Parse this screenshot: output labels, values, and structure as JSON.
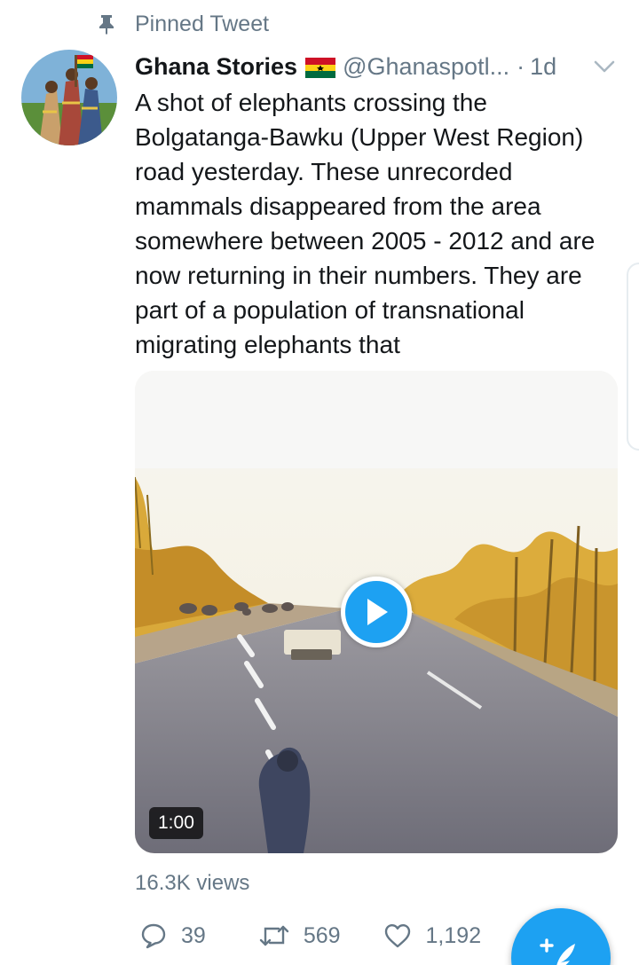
{
  "pinned": {
    "label": "Pinned Tweet",
    "icon": "pin-icon"
  },
  "tweet": {
    "author_name": "Ghana Stories",
    "flag_icon": "ghana-flag-icon",
    "handle": "@Ghanaspotl...",
    "separator": "·",
    "time": "1d",
    "text": "A shot of elephants crossing the Bolgatanga-Bawku (Upper West Region) road yesterday. These unrecorded mammals disappeared from the area somewhere between 2005 - 2012 and are now returning in their numbers. They are part of a population of transnational migrating elephants that",
    "video_duration": "1:00",
    "views": "16.3K views",
    "replies": "39",
    "retweets": "569",
    "likes": "1,192"
  },
  "colors": {
    "accent": "#1da1f2",
    "muted_text": "#657786",
    "primary_text": "#14171a",
    "flag_red": "#ce1126",
    "flag_gold": "#fcd116",
    "flag_green": "#006b3f"
  }
}
